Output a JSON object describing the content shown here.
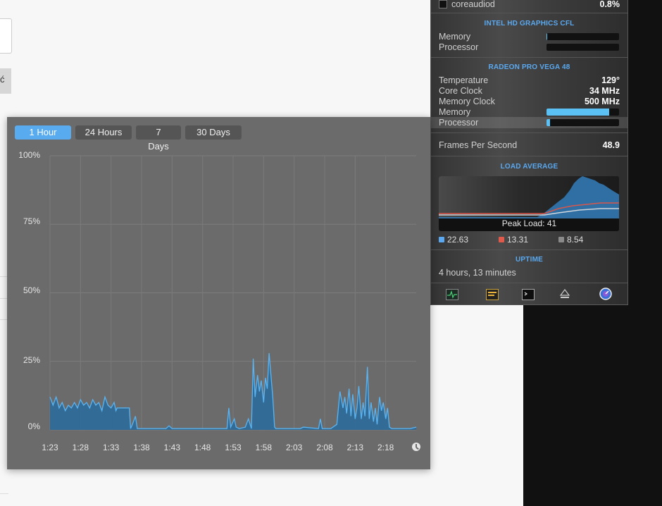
{
  "colors": {
    "accent": "#58abef",
    "series_fill": "#2f6c99",
    "series_line": "#5bb4f2",
    "legend_blue": "#5aa9f0",
    "legend_red": "#e05a4b",
    "legend_gray": "#8a8a8a"
  },
  "stats": {
    "top_process": {
      "name": "coreaudiod",
      "value": "0.8%",
      "icon": "terminal-icon"
    },
    "intel": {
      "title": "INTEL HD GRAPHICS CFL",
      "memory_label": "Memory",
      "processor_label": "Processor",
      "memory_fraction": 0.01,
      "processor_fraction": 0.0
    },
    "radeon": {
      "title": "RADEON PRO VEGA 48",
      "temperature_label": "Temperature",
      "temperature": "129°",
      "core_clock_label": "Core Clock",
      "core_clock": "34 MHz",
      "memory_clock_label": "Memory Clock",
      "memory_clock": "500 MHz",
      "memory_label": "Memory",
      "processor_label": "Processor",
      "memory_fraction": 0.86,
      "processor_fraction": 0.05
    },
    "fps_label": "Frames Per Second",
    "fps": "48.9",
    "load_title": "LOAD AVERAGE",
    "peak_load": "Peak Load: 41",
    "load_values": [
      "22.63",
      "13.31",
      "8.54"
    ],
    "uptime_title": "UPTIME",
    "uptime": "4 hours, 13 minutes",
    "toolbar_icons": [
      "activity-monitor-icon",
      "console-icon",
      "terminal-icon",
      "eject-icon",
      "istat-icon"
    ]
  },
  "history": {
    "tabs": [
      "1 Hour",
      "24 Hours",
      "7 Days",
      "30 Days"
    ],
    "active_tab": 0,
    "ylabels": [
      "100%",
      "75%",
      "50%",
      "25%",
      "0%"
    ],
    "xlabels": [
      "1:23",
      "1:28",
      "1:33",
      "1:38",
      "1:43",
      "1:48",
      "1:53",
      "1:58",
      "2:03",
      "2:08",
      "2:13",
      "2:18"
    ]
  },
  "chart_data": {
    "type": "area",
    "title": "",
    "xlabel": "",
    "ylabel": "",
    "ylim": [
      0,
      100
    ],
    "xlim": [
      0,
      60
    ],
    "grid": true,
    "series": [
      {
        "values": [
          [
            0,
            12
          ],
          [
            0.5,
            9
          ],
          [
            1,
            12
          ],
          [
            1.5,
            8
          ],
          [
            2,
            10
          ],
          [
            2.5,
            7
          ],
          [
            3,
            9
          ],
          [
            3.5,
            8
          ],
          [
            4,
            10
          ],
          [
            4.5,
            8
          ],
          [
            5,
            11
          ],
          [
            5.5,
            9
          ],
          [
            6,
            10
          ],
          [
            6.5,
            8
          ],
          [
            7,
            11
          ],
          [
            7.5,
            9
          ],
          [
            8,
            10
          ],
          [
            8.5,
            7
          ],
          [
            9,
            12
          ],
          [
            9.5,
            9
          ],
          [
            10,
            8
          ],
          [
            10.5,
            10
          ],
          [
            10.8,
            7
          ],
          [
            11,
            8
          ],
          [
            12,
            8
          ],
          [
            13,
            8
          ],
          [
            13.2,
            0.5
          ],
          [
            13.5,
            2
          ],
          [
            14,
            5
          ],
          [
            14.3,
            0.5
          ],
          [
            15,
            0.5
          ],
          [
            19,
            0.5
          ],
          [
            19.5,
            1.5
          ],
          [
            20,
            0.5
          ],
          [
            29,
            0.5
          ],
          [
            29.3,
            8
          ],
          [
            29.6,
            1
          ],
          [
            30.2,
            4
          ],
          [
            30.5,
            1
          ],
          [
            31,
            0.5
          ],
          [
            32,
            1
          ],
          [
            32.5,
            4
          ],
          [
            33,
            0.5
          ],
          [
            33.3,
            26
          ],
          [
            33.6,
            12
          ],
          [
            34,
            20
          ],
          [
            34.3,
            14
          ],
          [
            34.6,
            18
          ],
          [
            35,
            10
          ],
          [
            35.3,
            19
          ],
          [
            35.6,
            15
          ],
          [
            35.9,
            28
          ],
          [
            36.2,
            20
          ],
          [
            36.5,
            12
          ],
          [
            36.8,
            1
          ],
          [
            37,
            0.5
          ],
          [
            41,
            0.5
          ],
          [
            41.5,
            1
          ],
          [
            44,
            0.5
          ],
          [
            44.3,
            4
          ],
          [
            44.6,
            0.5
          ],
          [
            46,
            0.5
          ],
          [
            47,
            2
          ],
          [
            47.5,
            14
          ],
          [
            48,
            8
          ],
          [
            48.3,
            12
          ],
          [
            48.6,
            6
          ],
          [
            49,
            15
          ],
          [
            49.3,
            5
          ],
          [
            49.6,
            13
          ],
          [
            50,
            4
          ],
          [
            50.3,
            8
          ],
          [
            50.6,
            16
          ],
          [
            51,
            4
          ],
          [
            51.3,
            10
          ],
          [
            51.6,
            5
          ],
          [
            52,
            23
          ],
          [
            52.3,
            4
          ],
          [
            52.6,
            10
          ],
          [
            53,
            3
          ],
          [
            53.3,
            8
          ],
          [
            53.6,
            2
          ],
          [
            54,
            12
          ],
          [
            54.3,
            7
          ],
          [
            54.6,
            10
          ],
          [
            55,
            4
          ],
          [
            55.3,
            8
          ],
          [
            55.6,
            1
          ],
          [
            56,
            0.5
          ],
          [
            59,
            0.5
          ],
          [
            60,
            1
          ]
        ]
      }
    ]
  }
}
